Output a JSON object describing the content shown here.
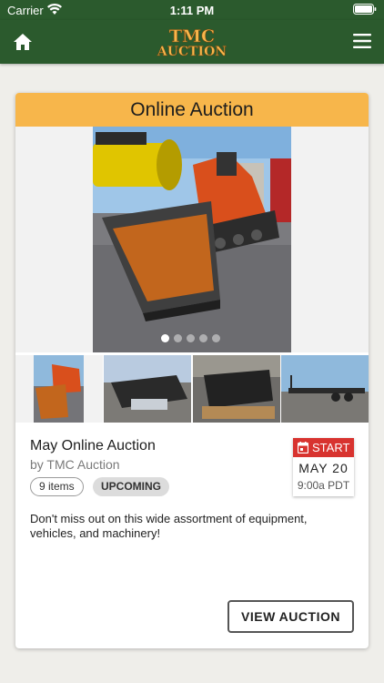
{
  "status_bar": {
    "carrier": "Carrier",
    "time": "1:11 PM"
  },
  "nav": {
    "logo_line1": "TMC",
    "logo_line2": "AUCTION",
    "home_icon": "home-icon",
    "menu_icon": "hamburger-menu-icon"
  },
  "auction": {
    "header": "Online Auction",
    "title": "May Online Auction",
    "byline": "by TMC Auction",
    "items_badge": "9 items",
    "status_badge": "UPCOMING",
    "date_label": "START",
    "date_day": "MAY 20",
    "date_time": "9:00a PDT",
    "description": "Don't miss out on this wide assortment of equipment, vehicles, and machinery!",
    "cta": "VIEW AUCTION",
    "gallery_image_count": 5,
    "active_image_index": 0
  },
  "colors": {
    "header_green": "#2b5a2d",
    "logo_gold": "#f7b64b",
    "card_header": "#f7b64b",
    "date_red": "#d8332f"
  }
}
